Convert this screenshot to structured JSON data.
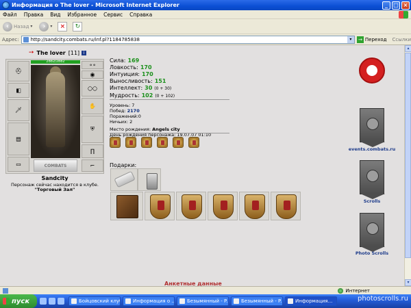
{
  "window": {
    "title": "Информация о The lover - Microsoft Internet Explorer"
  },
  "menu": [
    "Файл",
    "Правка",
    "Вид",
    "Избранное",
    "Сервис",
    "Справка"
  ],
  "toolbar": {
    "back_label": "Назад"
  },
  "address": {
    "label": "Адрес:",
    "url": "http://sandcity.combats.ru/inf.pl?1184785838",
    "go_label": "Переход",
    "links_label": "Ссылки"
  },
  "character": {
    "name": "The lover",
    "level": "[11]",
    "hp": "2882/2882",
    "emblem_text": "COMBATS",
    "city": "Sandcity",
    "location_text": "Персонаж сейчас находится в клубе.",
    "room": "\"Торговый Зал\"",
    "stats": [
      {
        "label": "Сила:",
        "value": "169",
        "extra": ""
      },
      {
        "label": "Ловкость:",
        "value": "170",
        "extra": ""
      },
      {
        "label": "Интуиция:",
        "value": "170",
        "extra": ""
      },
      {
        "label": "Выносливость:",
        "value": "151",
        "extra": ""
      },
      {
        "label": "Интеллект:",
        "value": "30",
        "extra": "(0 + 30)"
      },
      {
        "label": "Мудрость:",
        "value": "102",
        "extra": "(0 + 102)"
      }
    ],
    "info": {
      "level_label": "Уровень:",
      "level_value": "7",
      "wins_label": "Побед:",
      "wins_value": "2170",
      "losses_label": "Поражений:",
      "losses_value": "0",
      "draws_label": "Ничьих:",
      "draws_value": "2",
      "birthplace_label": "Место рождения:",
      "birthplace_value": "Angels city",
      "birthday_label": "День рождения персонажа:",
      "birthday_value": "19.07.07 01:10"
    },
    "gifts_label": "Подарки:",
    "section_title": "Анкетные данные"
  },
  "sidebar": {
    "events_label": "events.combats.ru",
    "scrolls_label": "Scrolls",
    "photo_label": "Photo Scrolls"
  },
  "status": {
    "zone": "Интернет"
  },
  "taskbar": {
    "start": "пуск",
    "tasks": [
      "Бойцовский клуб...",
      "Информация о ...",
      "Безымянный - P...",
      "Безымянный - P...",
      "Информация..."
    ]
  },
  "watermark": "photoscrolls.ru"
}
